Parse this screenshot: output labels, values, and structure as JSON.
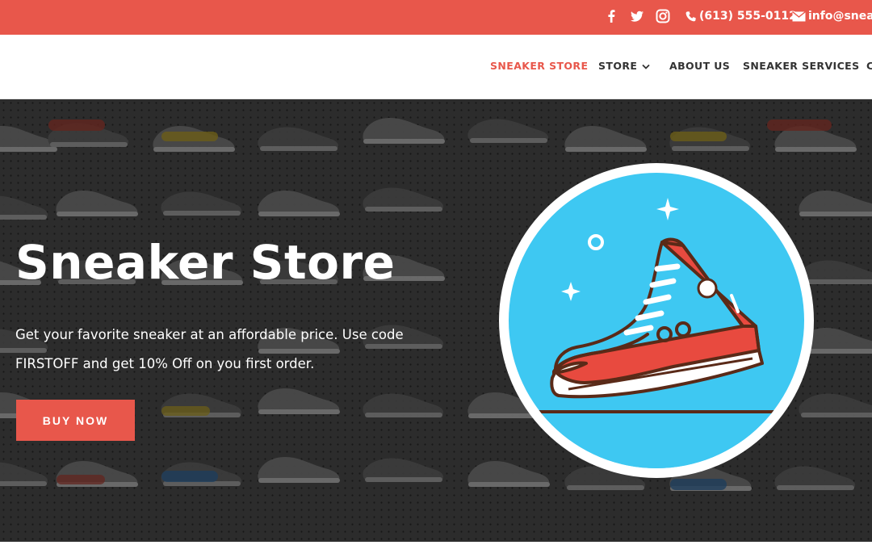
{
  "topbar": {
    "background": "#e8574b",
    "social_icons": [
      "facebook-icon",
      "twitter-icon",
      "instagram-icon"
    ],
    "phone": "(613) 555-0112",
    "email": "info@sneak"
  },
  "nav": {
    "items": [
      {
        "label": "SNEAKER STORE",
        "active": true
      },
      {
        "label": "STORE",
        "dropdown": true
      },
      {
        "label": "ABOUT US"
      },
      {
        "label": "SNEAKER SERVICES"
      },
      {
        "label": "C"
      }
    ],
    "active_color": "#e8574b"
  },
  "hero": {
    "title": "Sneaker Store",
    "description": "Get your favorite sneaker at an affordable price. Use code FIRSTOFF and get 10% Off on you first order.",
    "button_label": "BUY NOW",
    "button_color": "#e8574b",
    "illustration": "red-high-top-sneaker-icon",
    "illustration_bg": "#3ec8f2"
  }
}
